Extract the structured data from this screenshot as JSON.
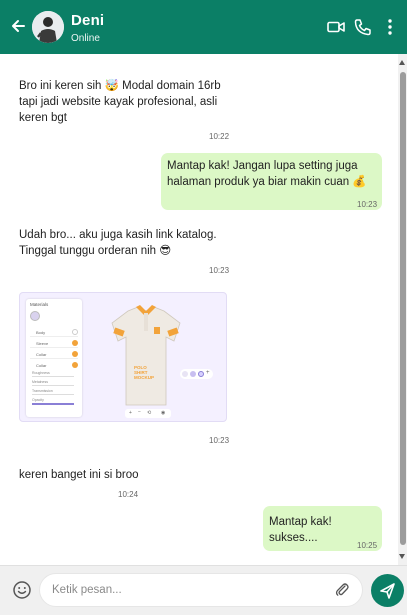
{
  "header": {
    "name": "Deni",
    "status": "Online",
    "colors": {
      "primary": "#0b7f66",
      "outgoing_bubble": "#dcf8c6"
    },
    "icons": [
      "back-arrow-icon",
      "video-call-icon",
      "phone-icon",
      "more-vertical-icon"
    ]
  },
  "messages": [
    {
      "direction": "in",
      "text": "Bro ini keren sih 🤯 Modal domain 16rb\ntapi jadi website kayak profesional, asli\nkeren bgt",
      "time": "10:22"
    },
    {
      "direction": "out",
      "text": "Mantap kak! Jangan lupa setting juga\nhalaman produk ya biar makin cuan 💰",
      "time": "10:23"
    },
    {
      "direction": "in",
      "text": "Udah bro... aku juga kasih link katalog.\nTinggal tunggu orderan nih 😎",
      "time": "10:23"
    },
    {
      "direction": "in",
      "type": "image",
      "time": "10:23"
    },
    {
      "direction": "in",
      "text": "keren banget ini si broo",
      "time": "10:24"
    },
    {
      "direction": "out",
      "text": "Mantap kak! sukses....",
      "time": "10:25"
    }
  ],
  "product_card": {
    "panel_title": "Materials",
    "options": [
      "Body",
      "Sleeve",
      "Collar",
      "Collar"
    ],
    "sliders": [
      "Roughness",
      "Metalness",
      "Transmission",
      "Opacity"
    ],
    "shirt_text": "POLO\nSHIRT\nMOCKUP"
  },
  "composer": {
    "placeholder": "Ketik pesan...",
    "icons": [
      "emoji-icon",
      "attach-icon",
      "send-icon"
    ]
  }
}
